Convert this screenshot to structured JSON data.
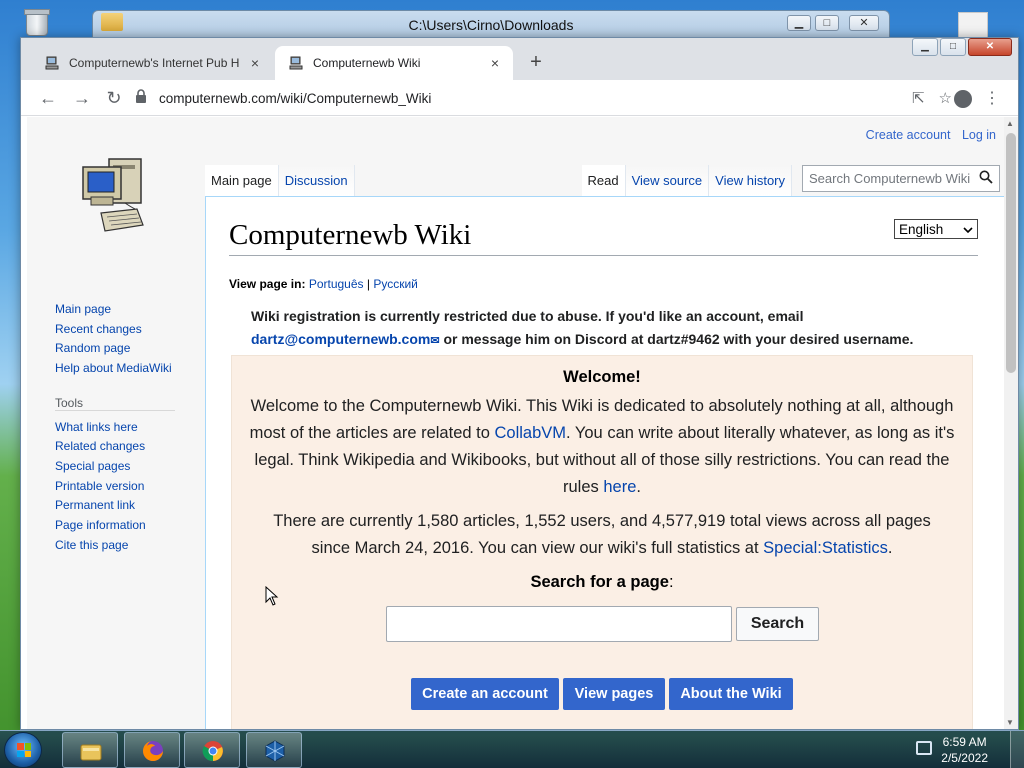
{
  "explorer": {
    "title": "C:\\Users\\Cirno\\Downloads"
  },
  "browser": {
    "tabs": [
      {
        "title": "Computernewb's Internet Pub H",
        "close": "×"
      },
      {
        "title": "Computernewb Wiki",
        "close": "×"
      }
    ],
    "new_tab": "+",
    "url": "computernewb.com/wiki/Computernewb_Wiki"
  },
  "wiki": {
    "personal": {
      "create_account": "Create account",
      "log_in": "Log in"
    },
    "nav_tabs": {
      "main_page": "Main page",
      "discussion": "Discussion",
      "read": "Read",
      "view_source": "View source",
      "view_history": "View history"
    },
    "search_placeholder": "Search Computernewb Wiki",
    "sidebar": {
      "navigation": [
        "Main page",
        "Recent changes",
        "Random page",
        "Help about MediaWiki"
      ],
      "tools_heading": "Tools",
      "tools": [
        "What links here",
        "Related changes",
        "Special pages",
        "Printable version",
        "Permanent link",
        "Page information",
        "Cite this page"
      ]
    },
    "page_title": "Computernewb Wiki",
    "language_select": "English",
    "view_page_in": {
      "label": "View page in:",
      "pt": "Português",
      "sep": "|",
      "ru": "Русский"
    },
    "notice": {
      "text1": "Wiki registration is currently restricted due to abuse. If you'd like an account, email",
      "email": "dartz@computernewb.com",
      "text2": " or message him on Discord at dartz#9462 with your desired username."
    },
    "welcome": {
      "title": "Welcome!",
      "p1_a": "Welcome to the Computernewb Wiki. This Wiki is dedicated to absolutely nothing at all, although most of the articles are related to ",
      "p1_link": "CollabVM",
      "p1_b": ". You can write about literally whatever, as long as it's legal. Think Wikipedia and Wikibooks, but without all of those silly restrictions. You can read the rules ",
      "p1_link2": "here",
      "p1_c": ".",
      "stats_a": "There are currently 1,580 articles, 1,552 users, and 4,577,919 total views across all pages since March 24, 2016. You can view our wiki's full statistics at ",
      "stats_link": "Special:Statistics",
      "stats_b": "."
    },
    "search_section": {
      "label": "Search for a page",
      "colon": ":",
      "button": "Search"
    },
    "buttons": {
      "create_account": "Create an account",
      "view_pages": "View pages",
      "about": "About the Wiki"
    }
  },
  "taskbar": {
    "time": "6:59 AM",
    "date": "2/5/2022"
  },
  "colors": {
    "link": "#0645ad",
    "accent_button": "#3366cc",
    "welcome_bg": "#fbefe5"
  }
}
